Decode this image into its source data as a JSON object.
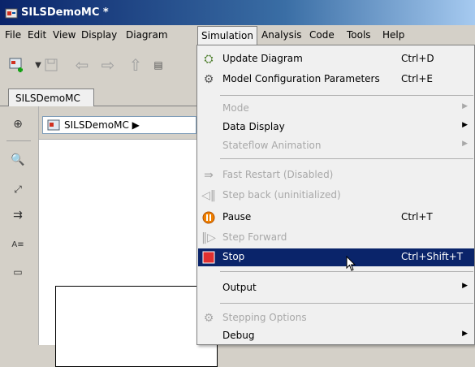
{
  "window": {
    "title": "SILSDemoMC *"
  },
  "menubar": [
    "File",
    "Edit",
    "View",
    "Display",
    "Diagram",
    "Simulation",
    "Analysis",
    "Code",
    "Tools",
    "Help"
  ],
  "tab": {
    "label": "SILSDemoMC"
  },
  "breadcrumb": {
    "label": "SILSDemoMC ▶"
  },
  "simulation_menu": {
    "items": [
      {
        "label": "Update Diagram",
        "shortcut": "Ctrl+D",
        "icon": "update-diagram-icon",
        "enabled": true
      },
      {
        "label": "Model Configuration Parameters",
        "shortcut": "Ctrl+E",
        "icon": "gear-icon",
        "enabled": true
      },
      {
        "label": "Mode",
        "shortcut": "",
        "icon": "",
        "enabled": false,
        "submenu": true
      },
      {
        "label": "Data Display",
        "shortcut": "",
        "icon": "",
        "enabled": true,
        "submenu": true
      },
      {
        "label": "Stateflow Animation",
        "shortcut": "",
        "icon": "",
        "enabled": false,
        "submenu": true
      },
      {
        "label": "Fast Restart (Disabled)",
        "shortcut": "",
        "icon": "fast-restart-icon",
        "enabled": false
      },
      {
        "label": "Step back (uninitialized)",
        "shortcut": "",
        "icon": "step-back-icon",
        "enabled": false
      },
      {
        "label": "Pause",
        "shortcut": "Ctrl+T",
        "icon": "pause-icon",
        "enabled": true
      },
      {
        "label": "Step Forward",
        "shortcut": "",
        "icon": "step-forward-icon",
        "enabled": false
      },
      {
        "label": "Stop",
        "shortcut": "Ctrl+Shift+T",
        "icon": "stop-icon",
        "enabled": true,
        "highlighted": true
      },
      {
        "label": "Output",
        "shortcut": "",
        "icon": "",
        "enabled": true,
        "submenu": true
      },
      {
        "label": "Stepping Options",
        "shortcut": "",
        "icon": "stepping-options-icon",
        "enabled": false
      },
      {
        "label": "Debug",
        "shortcut": "",
        "icon": "",
        "enabled": true,
        "submenu": true
      }
    ]
  },
  "colors": {
    "highlight": "#0a246a",
    "menu_bg": "#f0f0f0",
    "stop_red": "#e03030",
    "pause_orange": "#f08000"
  }
}
